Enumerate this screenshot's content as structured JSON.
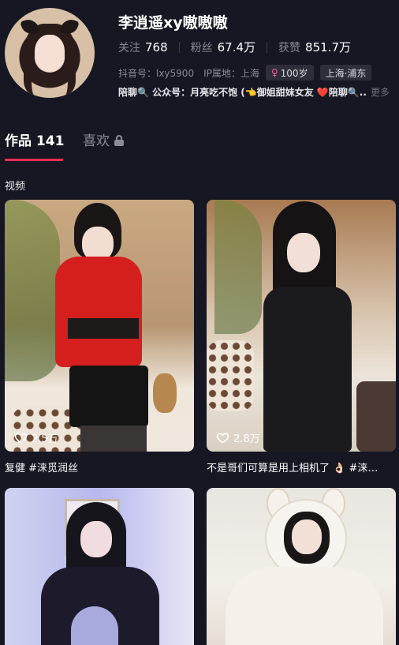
{
  "profile": {
    "name": "李逍遥xy嗷嗷嗷",
    "stats": [
      {
        "label": "关注",
        "value": "768"
      },
      {
        "label": "粉丝",
        "value": "67.4万"
      },
      {
        "label": "获赞",
        "value": "851.7万"
      }
    ],
    "douyin_id": "抖音号：lxy5900",
    "ip_location": "IP属地：上海",
    "age_tag": "100岁",
    "location_tag": "上海·浦东",
    "bio": "陪聊🔍 公众号：月亮吃不饱 (👈御姐甜妹女友 ❤️陪聊🔍...",
    "bio_more": "更多"
  },
  "tabs": {
    "works_label": "作品 141",
    "likes_label": "喜欢"
  },
  "section_title": "视频",
  "videos": [
    {
      "likes": "2.5万",
      "caption": "复健 #涞觅润丝"
    },
    {
      "likes": "2.8万",
      "caption": "不是哥们可算是用上相机了 👌🏻 #涞…"
    },
    {
      "likes": "",
      "caption": ""
    },
    {
      "likes": "",
      "caption": ""
    }
  ],
  "colors": {
    "background": "#161722",
    "accent": "#fe2c55",
    "muted_text": "#8a8b94",
    "tag_bg": "#2d2e3a"
  },
  "icons": {
    "lock": "lock-icon",
    "heart": "heart-outline-icon",
    "age_symbol": "female-symbol-icon"
  }
}
